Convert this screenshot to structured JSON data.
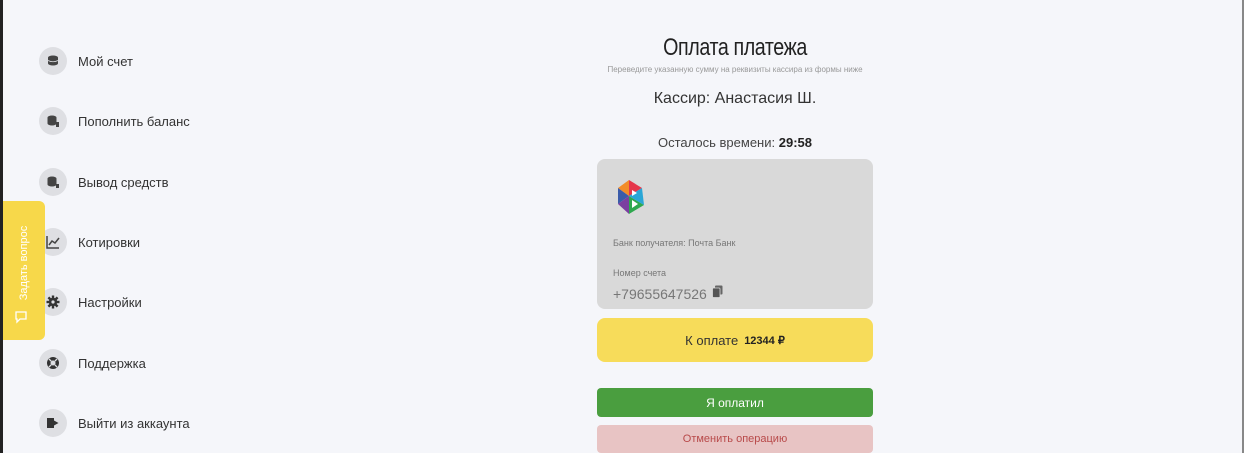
{
  "sidebar": {
    "items": [
      {
        "label": "Мой счет",
        "icon": "wallet-icon"
      },
      {
        "label": "Пополнить баланс",
        "icon": "deposit-icon"
      },
      {
        "label": "Вывод средств",
        "icon": "withdraw-icon"
      },
      {
        "label": "Котировки",
        "icon": "chart-icon"
      },
      {
        "label": "Настройки",
        "icon": "gear-icon"
      },
      {
        "label": "Поддержка",
        "icon": "support-icon"
      },
      {
        "label": "Выйти из аккаунта",
        "icon": "logout-icon"
      }
    ]
  },
  "ask_tab": {
    "label": "Задать вопрос",
    "icon": "chat-icon"
  },
  "main": {
    "title": "Оплата платежа",
    "subtitle": "Переведите указанную сумму на реквизиты кассира из формы ниже",
    "cashier": "Кассир: Анастасия Ш.",
    "timer_label": "Осталось времени:",
    "timer_value": "29:58"
  },
  "card": {
    "bank_name": "Банк получателя: Почта Банк",
    "account_label": "Номер счета",
    "account_number": "+79655647526",
    "logo": "pochta-bank-logo"
  },
  "payment": {
    "label": "К оплате",
    "amount": "12344 ₽"
  },
  "buttons": {
    "paid": "Я оплатил",
    "cancel": "Отменить операцию"
  },
  "colors": {
    "background": "#f5f6fa",
    "accent_yellow": "#f7dc5a",
    "paid_green": "#4a9e3f",
    "cancel_red_bg": "#e8c4c4",
    "cancel_red_text": "#b84a4a",
    "card_grey": "#d9d9d9"
  }
}
